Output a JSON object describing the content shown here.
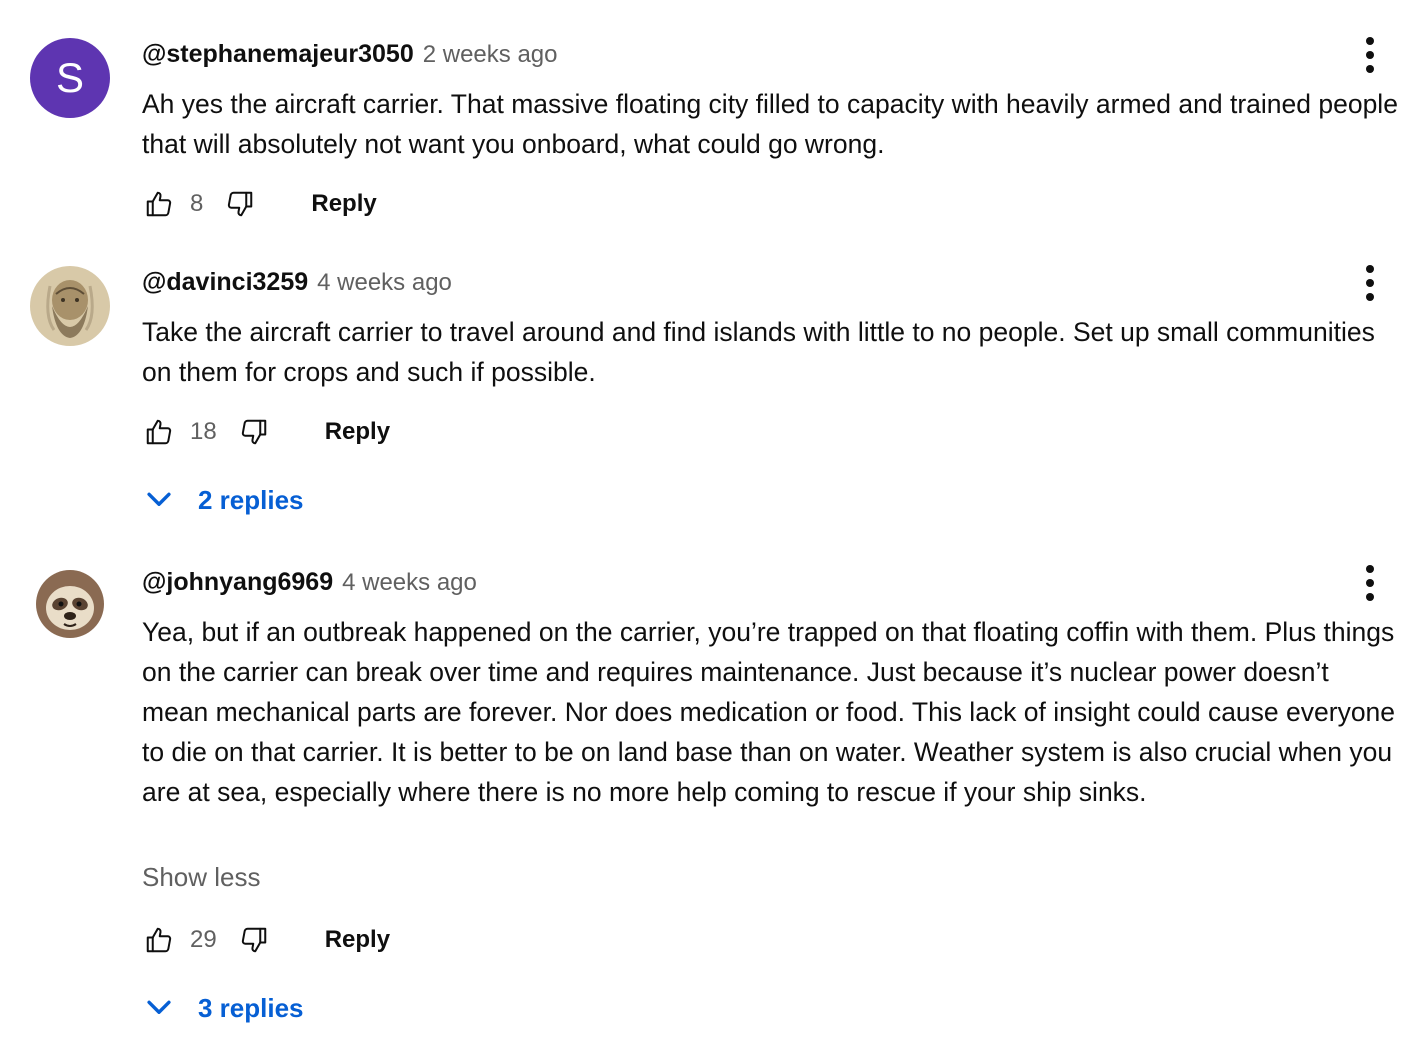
{
  "comments": [
    {
      "author": "@stephanemajeur3050",
      "time": "2 weeks ago",
      "avatar_letter": "S",
      "text": "Ah yes the aircraft carrier. That massive floating city filled to capacity with heavily armed and trained people that will absolutely not want you onboard, what could go wrong.",
      "likes": "8",
      "reply_label": "Reply"
    },
    {
      "author": "@davinci3259",
      "time": "4 weeks ago",
      "text": "Take the aircraft carrier to travel around and find islands with little to no people. Set up small communities on them for crops and such if possible.",
      "likes": "18",
      "reply_label": "Reply",
      "replies_label": "2 replies"
    },
    {
      "author": "@johnyang6969",
      "time": "4 weeks ago",
      "text": "Yea, but if an outbreak happened on the carrier, you’re trapped on that floating coffin with them. Plus things on the carrier can break over time and requires maintenance. Just because it’s nuclear power doesn’t mean mechanical parts are forever. Nor does medication or food. This lack of insight could cause everyone to die on that carrier. It is better to be on land base than on water. Weather system is also crucial when you are at sea, especially where there is no more help coming to rescue if your ship sinks.",
      "show_less_label": "Show less",
      "likes": "29",
      "reply_label": "Reply",
      "replies_label": "3 replies"
    }
  ],
  "colors": {
    "accent_link": "#065fd4",
    "secondary_text": "#606060",
    "avatar_purple": "#5e35b1"
  },
  "icons": [
    "thumb-up-icon",
    "thumb-down-icon",
    "more-vert-icon",
    "chevron-down-icon"
  ]
}
